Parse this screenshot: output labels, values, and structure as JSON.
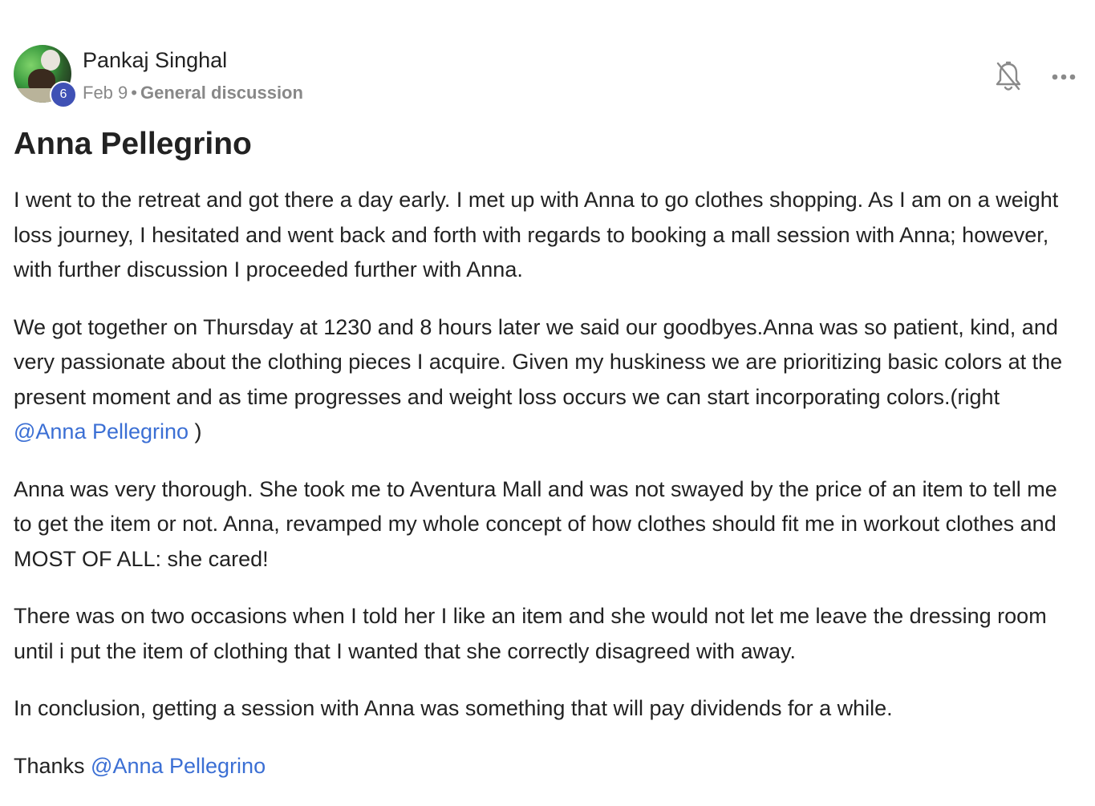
{
  "post": {
    "author": {
      "name": "Pankaj Singhal",
      "level": "6",
      "avatar_icon": "avatar-photo"
    },
    "date": "Feb 9",
    "separator": "•",
    "category": "General discussion",
    "actions": {
      "notification_icon": "bell-off-icon",
      "more_icon": "more-horizontal-icon"
    },
    "title": "Anna Pellegrino",
    "paragraphs": [
      {
        "text": "I went to the retreat and got there a day early. I met up with Anna to go clothes shopping. As I am on a weight loss journey, I hesitated and went back and forth with regards to booking a mall session with Anna; however, with further discussion I proceeded further with Anna."
      },
      {
        "text_before": "We got together on Thursday at 1230 and 8 hours later we said our goodbyes.Anna was so patient, kind, and very passionate about the clothing pieces I acquire. Given my huskiness we are prioritizing basic colors at the present moment and as time progresses and weight loss occurs we can start incorporating colors.(right ",
        "mention": "@Anna Pellegrino",
        "text_after": " )"
      },
      {
        "text": "Anna was very thorough. She took me to Aventura Mall and was not swayed by the price of an item to tell me to get the item or not. Anna, revamped my whole concept of how clothes should fit me in workout clothes and MOST OF ALL: she cared!"
      },
      {
        "text": "There was on two occasions when I told her I like an item and she would not let me leave the dressing room until i put the item of clothing that I wanted that she correctly disagreed with away."
      },
      {
        "text": "In conclusion, getting a session with Anna was something that will pay dividends for a while."
      },
      {
        "text_before": "Thanks ",
        "mention": "@Anna Pellegrino"
      }
    ],
    "colors": {
      "mention": "#3b6fd4",
      "badge": "#3f51b5",
      "meta": "#888888"
    }
  }
}
